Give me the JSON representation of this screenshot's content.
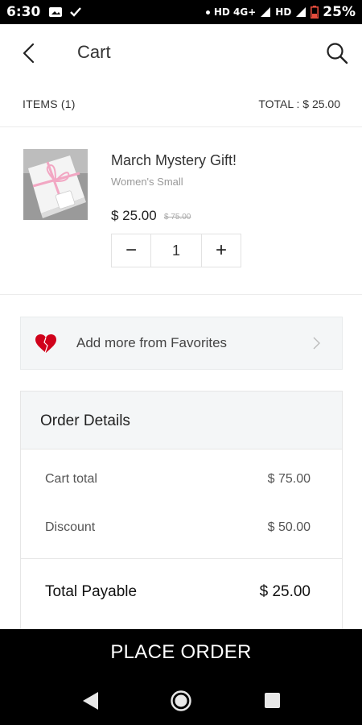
{
  "status_bar": {
    "time": "6:30",
    "network": "HD 4G+",
    "network2": "HD",
    "battery": "25%"
  },
  "header": {
    "title": "Cart"
  },
  "summary": {
    "items": "ITEMS (1)",
    "total": "TOTAL : $ 25.00"
  },
  "cart_item": {
    "name": "March Mystery Gift!",
    "variant": "Women's Small",
    "price": "$ 25.00",
    "old_price": "$ 75.00",
    "quantity": "1",
    "minus": "−",
    "plus": "+"
  },
  "favorites": {
    "label": "Add more from Favorites"
  },
  "order_details": {
    "title": "Order Details",
    "cart_total_label": "Cart total",
    "cart_total_value": "$ 75.00",
    "discount_label": "Discount",
    "discount_value": "$ 50.00",
    "total_label": "Total Payable",
    "total_value": "$ 25.00"
  },
  "place_order": {
    "label": "PLACE ORDER"
  },
  "icons": {
    "heart_color": "#d0021b",
    "accent_dark": "#000000"
  }
}
